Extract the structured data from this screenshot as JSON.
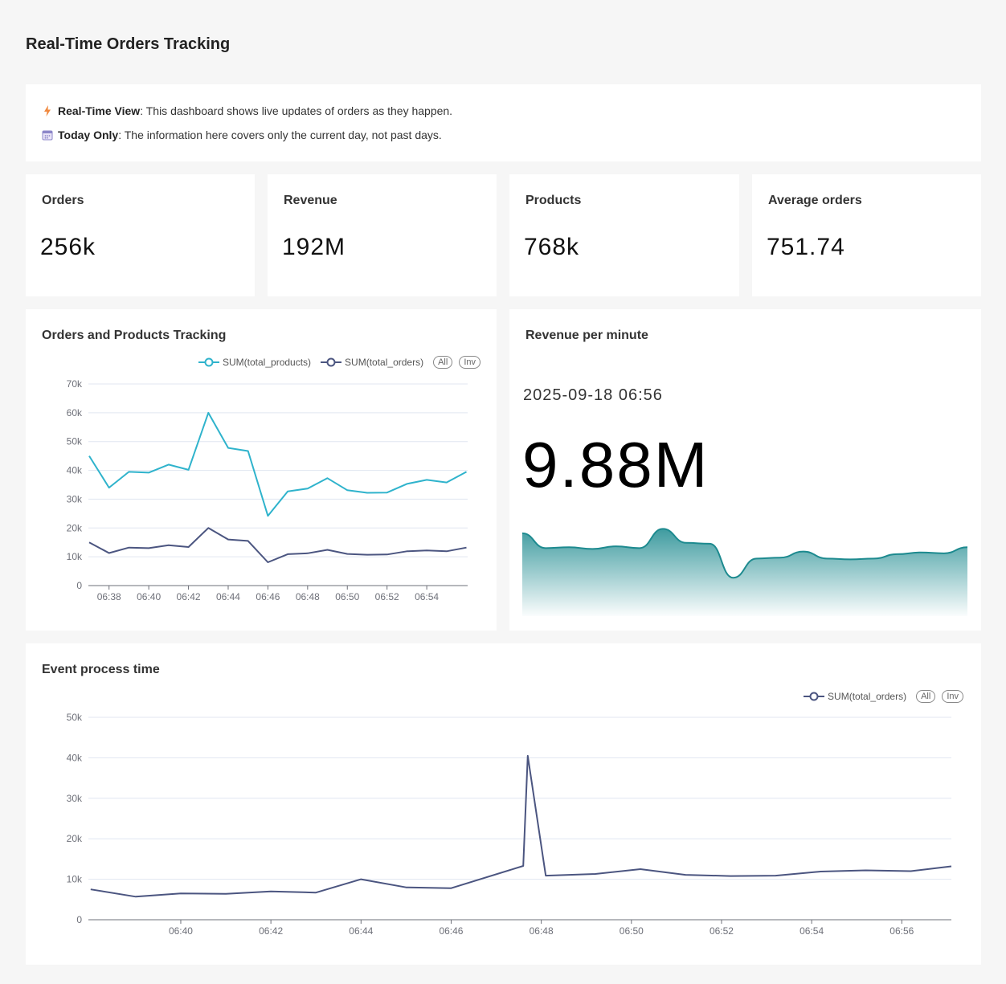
{
  "page": {
    "title": "Real-Time Orders Tracking"
  },
  "info": {
    "line1_bold": "Real-Time View",
    "line1_text": ": This dashboard shows live updates of orders as they happen.",
    "line2_bold": "Today Only",
    "line2_text": ": The information here covers only the current day, not past days."
  },
  "kpis": [
    {
      "label": "Orders",
      "value": "256k"
    },
    {
      "label": "Revenue",
      "value": "192M"
    },
    {
      "label": "Products",
      "value": "768k"
    },
    {
      "label": "Average orders",
      "value": "751.74"
    }
  ],
  "colors": {
    "products": "#2fb3cc",
    "orders": "#4b5580",
    "revenue": "#1d8a8f"
  },
  "icons": {
    "info1": "lightning-icon",
    "info2": "calendar-icon"
  },
  "legend": {
    "all": "All",
    "inv": "Inv"
  },
  "chart_data": [
    {
      "type": "line",
      "title": "Orders and Products Tracking",
      "x": [
        "06:37",
        "06:38",
        "06:39",
        "06:40",
        "06:41",
        "06:42",
        "06:43",
        "06:44",
        "06:45",
        "06:46",
        "06:47",
        "06:48",
        "06:49",
        "06:50",
        "06:51",
        "06:52",
        "06:53",
        "06:54",
        "06:55",
        "06:56"
      ],
      "x_ticks": [
        "06:38",
        "06:40",
        "06:42",
        "06:44",
        "06:46",
        "06:48",
        "06:50",
        "06:52",
        "06:54"
      ],
      "series": [
        {
          "name": "SUM(total_products)",
          "values": [
            45000,
            34000,
            39500,
            39200,
            42000,
            40200,
            60000,
            47800,
            46700,
            24200,
            32700,
            33700,
            37300,
            33100,
            32200,
            32300,
            35300,
            36700,
            35800,
            39500
          ]
        },
        {
          "name": "SUM(total_orders)",
          "values": [
            15000,
            11300,
            13200,
            13000,
            14000,
            13400,
            20000,
            16000,
            15500,
            8100,
            10900,
            11200,
            12400,
            11000,
            10700,
            10800,
            11900,
            12200,
            11900,
            13200
          ]
        }
      ],
      "y_ticks": [
        "0",
        "10k",
        "20k",
        "30k",
        "40k",
        "50k",
        "60k",
        "70k"
      ],
      "ylim": [
        0,
        70000
      ],
      "grid": true,
      "legend": "top-right"
    },
    {
      "type": "area",
      "title": "Revenue per minute",
      "timestamp": "2025-09-18 06:56",
      "big_number": "9.88M",
      "values": [
        9.5,
        7.8,
        7.9,
        7.7,
        8.0,
        7.8,
        10.0,
        8.4,
        8.3,
        4.4,
        6.6,
        6.7,
        7.4,
        6.6,
        6.5,
        6.6,
        7.1,
        7.3,
        7.2,
        7.9
      ]
    },
    {
      "type": "line",
      "title": "Event process time",
      "x": [
        "06:38",
        "06:39",
        "06:40",
        "06:41",
        "06:42",
        "06:43",
        "06:44",
        "06:45",
        "06:46",
        "06:47.6",
        "06:47.7",
        "06:48",
        "06:49",
        "06:50",
        "06:51",
        "06:52",
        "06:53",
        "06:54",
        "06:55",
        "06:56",
        "06:57"
      ],
      "x_numeric": [
        38.0,
        39.0,
        40.0,
        41.0,
        42.0,
        43.0,
        44.0,
        45.0,
        46.0,
        47.6,
        47.7,
        48.1,
        49.2,
        50.2,
        51.2,
        52.2,
        53.2,
        54.2,
        55.2,
        56.2,
        57.1
      ],
      "x_ticks": [
        "06:40",
        "06:42",
        "06:44",
        "06:46",
        "06:48",
        "06:50",
        "06:52",
        "06:54",
        "06:56"
      ],
      "series": [
        {
          "name": "SUM(total_orders)",
          "values": [
            7500,
            5700,
            6500,
            6400,
            7000,
            6700,
            10000,
            8000,
            7800,
            13300,
            40500,
            10900,
            11300,
            12500,
            11100,
            10800,
            10900,
            11900,
            12200,
            12000,
            13200
          ]
        }
      ],
      "y_ticks": [
        "0",
        "10k",
        "20k",
        "30k",
        "40k",
        "50k"
      ],
      "ylim": [
        0,
        50000
      ],
      "grid": true,
      "legend": "top-right"
    }
  ]
}
